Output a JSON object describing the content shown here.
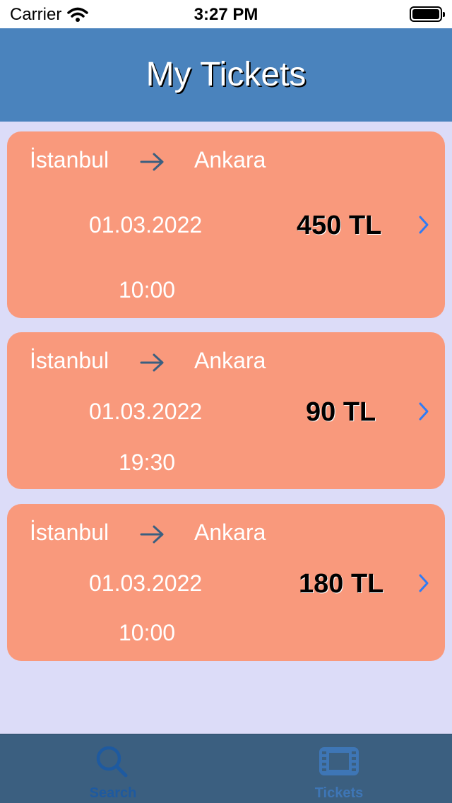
{
  "status": {
    "carrier": "Carrier",
    "time": "3:27 PM"
  },
  "nav": {
    "title": "My Tickets"
  },
  "tickets": [
    {
      "from": "İstanbul",
      "to": "Ankara",
      "date": "01.03.2022",
      "time": "10:00",
      "price": "450 TL"
    },
    {
      "from": "İstanbul",
      "to": "Ankara",
      "date": "01.03.2022",
      "time": "19:30",
      "price": "90 TL"
    },
    {
      "from": "İstanbul",
      "to": "Ankara",
      "date": "01.03.2022",
      "time": "10:00",
      "price": "180 TL"
    }
  ],
  "tabs": [
    {
      "label": "Search",
      "icon": "search-icon",
      "active": false
    },
    {
      "label": "Tickets",
      "icon": "film-icon",
      "active": true
    }
  ],
  "colors": {
    "nav_bg": "#4a83bd",
    "card_bg": "#f9997c",
    "page_bg": "#dcdcf8",
    "tab_bar_bg": "#3b5f80",
    "accent": "#2f7cf6"
  }
}
